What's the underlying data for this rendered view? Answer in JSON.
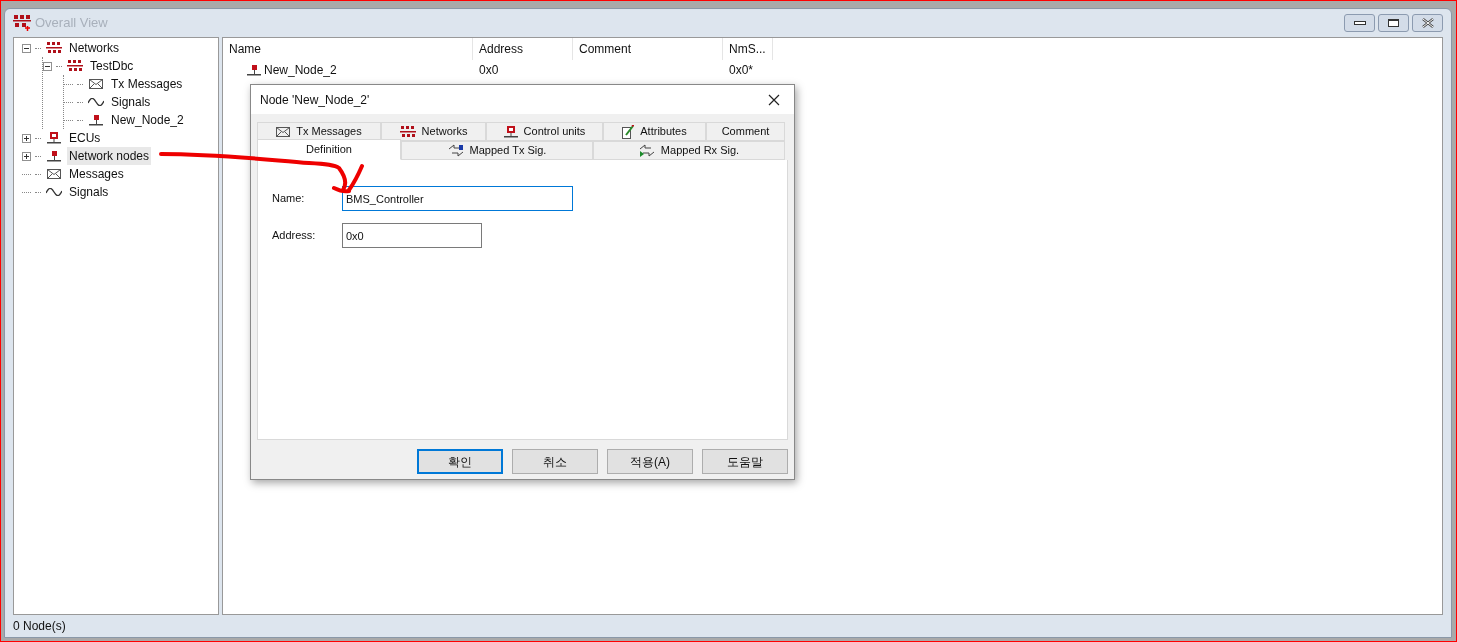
{
  "window": {
    "title": "Overall View"
  },
  "tree": [
    {
      "label": "Networks",
      "kind": "network",
      "expanded": true,
      "selected": false,
      "children": [
        {
          "label": "TestDbc",
          "kind": "network",
          "expanded": true,
          "selected": false,
          "children": [
            {
              "label": "Tx Messages",
              "kind": "message",
              "selected": false
            },
            {
              "label": "Signals",
              "kind": "signal",
              "selected": false
            },
            {
              "label": "New_Node_2",
              "kind": "node",
              "selected": false
            }
          ]
        }
      ]
    },
    {
      "label": "ECUs",
      "kind": "ecu",
      "expanded": false,
      "selected": false
    },
    {
      "label": "Network nodes",
      "kind": "node",
      "expanded": false,
      "selected": true
    },
    {
      "label": "Messages",
      "kind": "message",
      "selected": false
    },
    {
      "label": "Signals",
      "kind": "signal",
      "selected": false
    }
  ],
  "list": {
    "columns": [
      "Name",
      "Address",
      "Comment",
      "NmS..."
    ],
    "rows": [
      {
        "kind": "node",
        "name": "New_Node_2",
        "address": "0x0",
        "column_4": "0x0*"
      }
    ]
  },
  "dialog": {
    "title": "Node 'New_Node_2'",
    "tab_rows": [
      [
        {
          "label": "Tx Messages",
          "kind": "message",
          "selected": false
        },
        {
          "label": "Networks",
          "kind": "network",
          "selected": false
        },
        {
          "label": "Control units",
          "kind": "ecu",
          "selected": false
        },
        {
          "label": "Attributes",
          "kind": "attributes",
          "selected": false
        },
        {
          "label": "Comment",
          "kind": "plain",
          "selected": false
        }
      ],
      [
        {
          "label": "Definition",
          "kind": "plain",
          "selected": true
        },
        {
          "label": "Mapped Tx Sig.",
          "kind": "mapped_tx",
          "selected": false
        },
        {
          "label": "Mapped Rx Sig.",
          "kind": "mapped_rx",
          "selected": false
        }
      ]
    ],
    "fields": [
      {
        "label": "Name:",
        "value": "BMS_Controller",
        "focused": true
      },
      {
        "label": "Address:",
        "value": "0x0",
        "focused": false
      }
    ],
    "buttons": [
      {
        "label": "확인",
        "default": true
      },
      {
        "label": "취소",
        "default": false
      },
      {
        "label": "적용(A)",
        "default": false
      },
      {
        "label": "도움말",
        "default": false
      }
    ]
  },
  "status_bar": {
    "text": "0 Node(s)"
  }
}
